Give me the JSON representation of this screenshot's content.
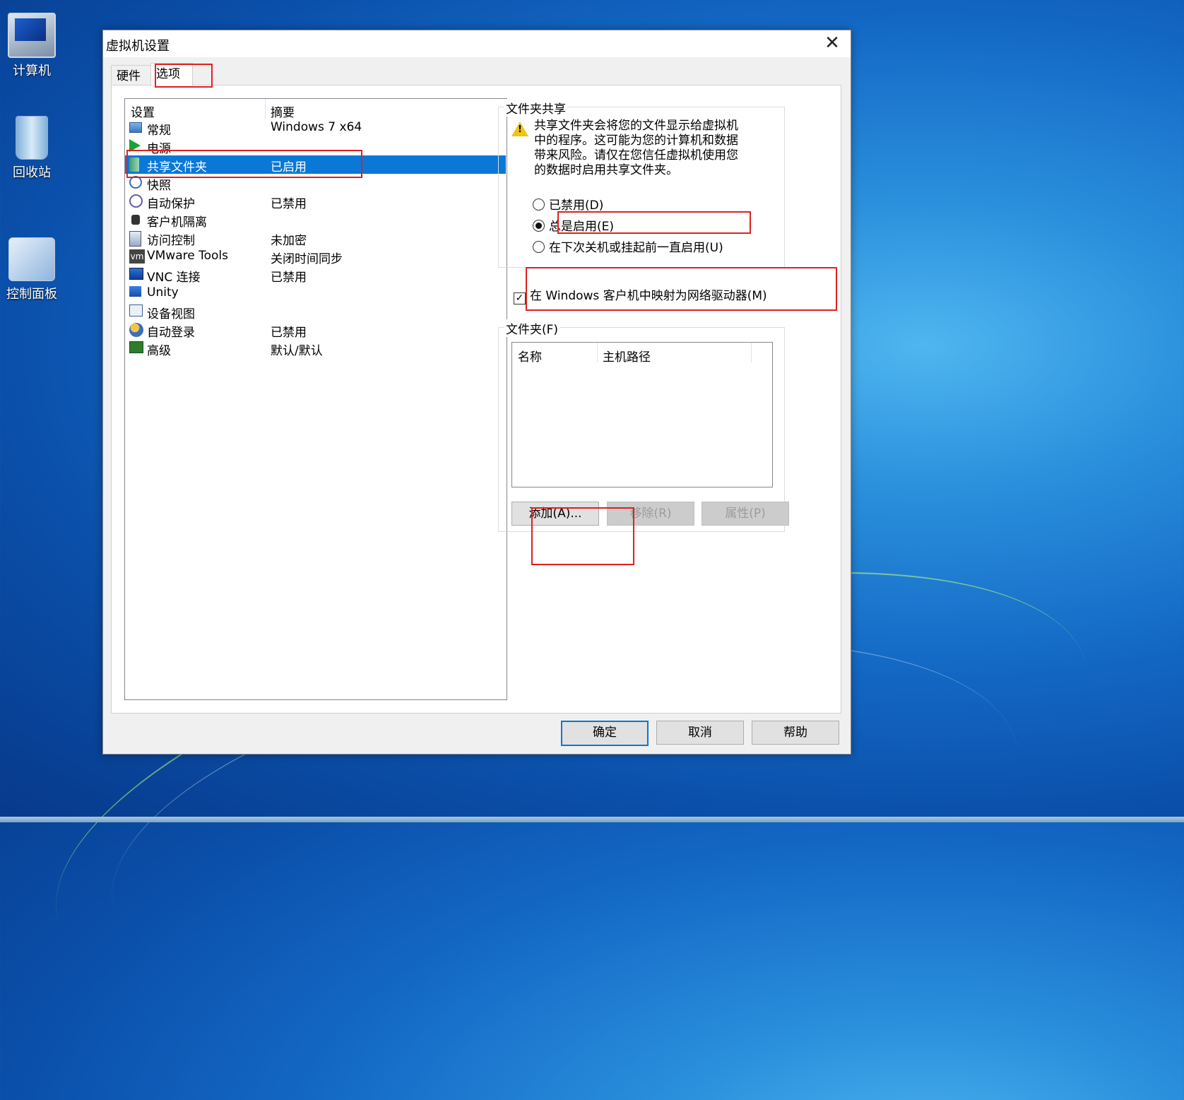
{
  "desktop": {
    "icons": [
      {
        "label": "计算机"
      },
      {
        "label": "回收站"
      },
      {
        "label": "控制面板"
      }
    ]
  },
  "dialog": {
    "title": "虚拟机设置",
    "tabs": [
      {
        "label": "硬件"
      },
      {
        "label": "选项"
      }
    ],
    "active_tab": "选项",
    "settings": {
      "header": {
        "col1": "设置",
        "col2": "摘要"
      },
      "rows": [
        {
          "name": "常规",
          "summary": "Windows 7 x64",
          "icon": "monitor-icon"
        },
        {
          "name": "电源",
          "summary": "",
          "icon": "play-icon"
        },
        {
          "name": "共享文件夹",
          "summary": "已启用",
          "icon": "shared-folder-icon"
        },
        {
          "name": "快照",
          "summary": "",
          "icon": "snapshot-icon"
        },
        {
          "name": "自动保护",
          "summary": "已禁用",
          "icon": "autoprotect-icon"
        },
        {
          "name": "客户机隔离",
          "summary": "",
          "icon": "lock-icon"
        },
        {
          "name": "访问控制",
          "summary": "未加密",
          "icon": "access-control-icon"
        },
        {
          "name": "VMware Tools",
          "summary": "关闭时间同步",
          "icon": "vmware-tools-icon"
        },
        {
          "name": "VNC 连接",
          "summary": "已禁用",
          "icon": "vnc-icon"
        },
        {
          "name": "Unity",
          "summary": "",
          "icon": "unity-icon"
        },
        {
          "name": "设备视图",
          "summary": "",
          "icon": "device-view-icon"
        },
        {
          "name": "自动登录",
          "summary": "已禁用",
          "icon": "autologin-icon"
        },
        {
          "name": "高级",
          "summary": "默认/默认",
          "icon": "advanced-icon"
        }
      ],
      "selected": "共享文件夹"
    },
    "folder_sharing": {
      "group_label": "文件夹共享",
      "warning": "共享文件夹会将您的文件显示给虚拟机中的程序。这可能为您的计算机和数据带来风险。请仅在您信任虚拟机使用您的数据时启用共享文件夹。",
      "options": [
        {
          "label": "已禁用(D)",
          "checked": false
        },
        {
          "label": "总是启用(E)",
          "checked": true
        },
        {
          "label": "在下次关机或挂起前一直启用(U)",
          "checked": false
        }
      ],
      "map_drive_label": "在 Windows 客户机中映射为网络驱动器(M)",
      "map_drive_checked": true,
      "map_drive_checkmark": "✓"
    },
    "folders": {
      "group_label": "文件夹(F)",
      "columns": [
        "名称",
        "主机路径"
      ],
      "buttons": {
        "add": "添加(A)...",
        "remove": "移除(R)",
        "properties": "属性(P)"
      }
    },
    "footer": {
      "ok": "确定",
      "cancel": "取消",
      "help": "帮助"
    },
    "close_glyph": "✕"
  }
}
